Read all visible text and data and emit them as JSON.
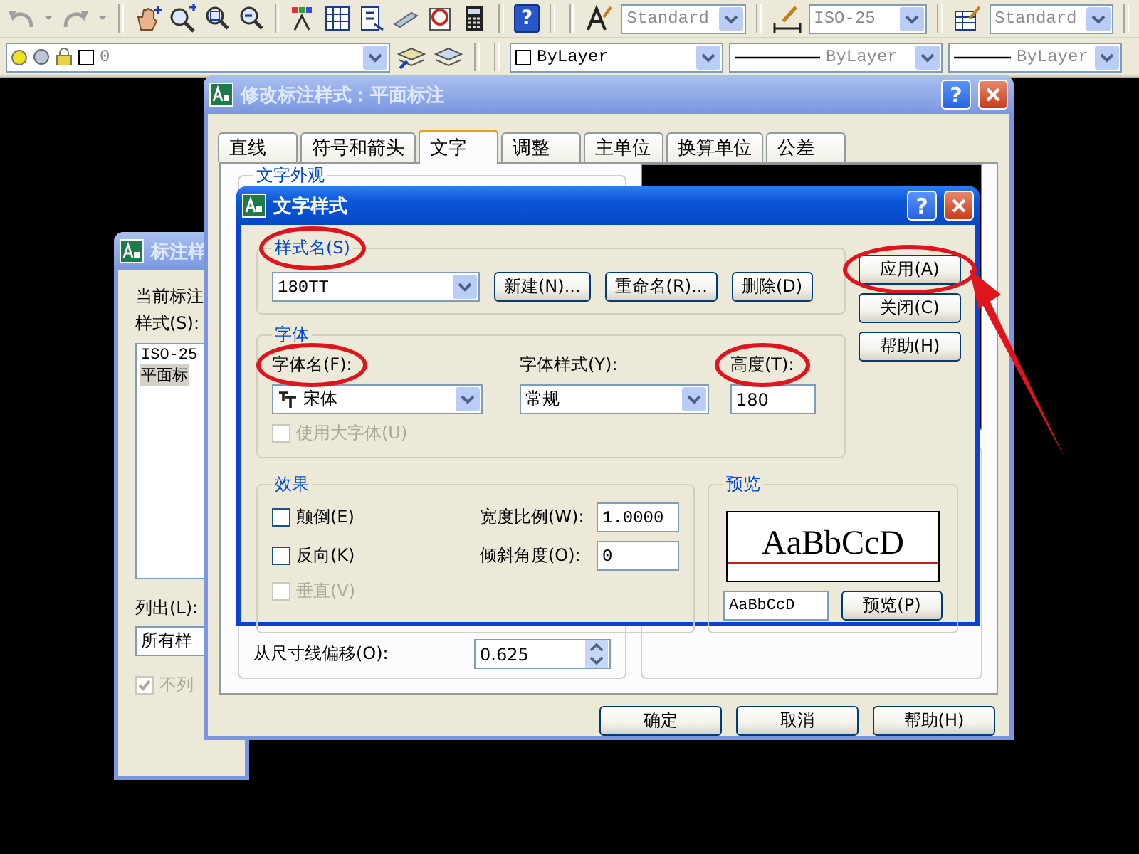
{
  "toolbar": {
    "style_combos": [
      {
        "kind": "text-style",
        "value": "Standard",
        "disabled": true
      },
      {
        "kind": "dimension-style",
        "value": "ISO-25",
        "disabled": true
      },
      {
        "kind": "table-style",
        "value": "Standard",
        "disabled": true
      }
    ],
    "layer_combo": {
      "value": "0",
      "disabled": true
    },
    "property_combos": [
      {
        "kind": "color",
        "value": "ByLayer",
        "disabled": false
      },
      {
        "kind": "linetype",
        "value": "ByLayer",
        "disabled": true
      },
      {
        "kind": "lineweight",
        "value": "ByLayer",
        "disabled": true
      }
    ],
    "help_glyph": "?"
  },
  "dimension_style_manager": {
    "title": "标注样",
    "current_label": "当前标注",
    "styles_label": "样式(S):",
    "styles": [
      {
        "name": "ISO-25",
        "selected": false
      },
      {
        "name": "平面标",
        "selected": true
      }
    ],
    "list_label": "列出(L):",
    "list_value": "所有样",
    "hide_xrefs": {
      "label": "不列",
      "checked": true,
      "disabled": true
    }
  },
  "modify_dimension_style": {
    "title": "修改标注样式：平面标注",
    "help_glyph": "?",
    "tabs": [
      {
        "label": "直线",
        "selected": false
      },
      {
        "label": "符号和箭头",
        "selected": false
      },
      {
        "label": "文字",
        "selected": true
      },
      {
        "label": "调整",
        "selected": false
      },
      {
        "label": "主单位",
        "selected": false
      },
      {
        "label": "换算单位",
        "selected": false
      },
      {
        "label": "公差",
        "selected": false
      }
    ],
    "group_title": "文字外观",
    "offset_label": "从尺寸线偏移(O):",
    "offset_value": "0.625",
    "buttons": [
      "确定",
      "取消",
      "帮助(H)"
    ]
  },
  "text_style": {
    "title": "文字样式",
    "help_glyph": "?",
    "style_group": {
      "label": "样式名(S)",
      "highlighted": true
    },
    "style_name": "180TT",
    "style_buttons": [
      "新建(N)...",
      "重命名(R)...",
      "删除(D)"
    ],
    "side_buttons": [
      {
        "label": "应用(A)",
        "highlighted": true,
        "arrow": true
      },
      {
        "label": "关闭(C)",
        "highlighted": false,
        "arrow": false
      },
      {
        "label": "帮助(H)",
        "highlighted": false,
        "arrow": false
      }
    ],
    "font_group": "字体",
    "font_name": {
      "label": "字体名(F):",
      "highlighted": true,
      "value": "宋体"
    },
    "font_style": {
      "label": "字体样式(Y):",
      "highlighted": false,
      "value": "常规"
    },
    "height": {
      "label": "高度(T):",
      "highlighted": true,
      "value": "180"
    },
    "big_font": {
      "label": "使用大字体(U)",
      "checked": false,
      "disabled": true
    },
    "effects_group": "效果",
    "effects": [
      {
        "label": "颠倒(E)",
        "checked": false,
        "disabled": false
      },
      {
        "label": "反向(K)",
        "checked": false,
        "disabled": false
      },
      {
        "label": "垂直(V)",
        "checked": false,
        "disabled": true
      }
    ],
    "width_factor": {
      "label": "宽度比例(W):",
      "value": "1.0000"
    },
    "oblique_angle": {
      "label": "倾斜角度(O):",
      "value": "0"
    },
    "preview_group": "预览",
    "preview_sample": "AaBbCcD",
    "preview_text": "AaBbCcD",
    "preview_button": "预览(P)"
  }
}
